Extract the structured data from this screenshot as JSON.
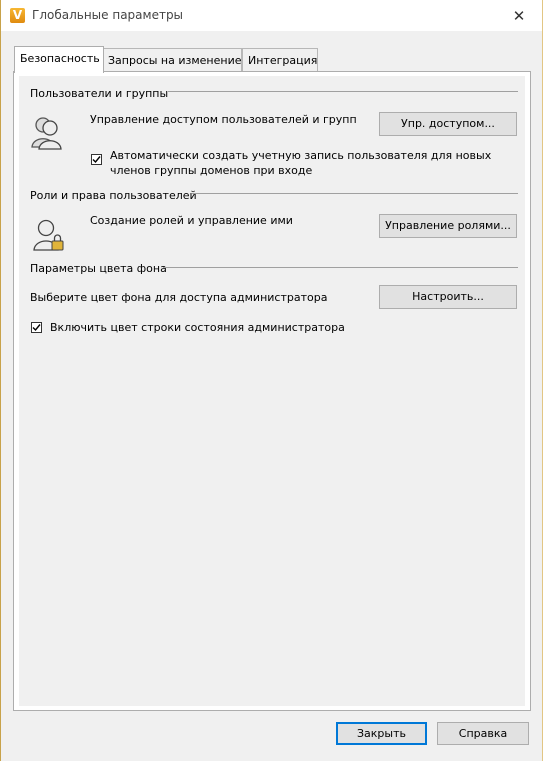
{
  "window": {
    "title": "Глобальные параметры",
    "app_icon_letter": "V",
    "close_glyph": "✕"
  },
  "tabs": [
    {
      "label": "Безопасность",
      "active": true
    },
    {
      "label": "Запросы на изменение",
      "active": false
    },
    {
      "label": "Интеграция",
      "active": false
    }
  ],
  "users_groups": {
    "heading": "Пользователи и группы",
    "description": "Управление доступом пользователей и групп",
    "button_label": "Упр. доступом...",
    "auto_create_checkbox": {
      "checked": true,
      "line1": "Автоматически создать учетную запись пользователя для новых",
      "line2": "членов группы доменов при входе"
    }
  },
  "roles": {
    "heading": "Роли и права пользователей",
    "description": "Создание ролей и управление ими",
    "button_label": "Управление ролями..."
  },
  "background": {
    "heading": "Параметры цвета фона",
    "description": "Выберите цвет фона для доступа администратора",
    "button_label": "Настроить...",
    "status_checkbox": {
      "checked": true,
      "label": "Включить цвет строки состояния администратора"
    }
  },
  "footer": {
    "close_label": "Закрыть",
    "help_label": "Справка"
  },
  "colors": {
    "accent": "#0078d7",
    "app_icon": "#f0a020"
  }
}
